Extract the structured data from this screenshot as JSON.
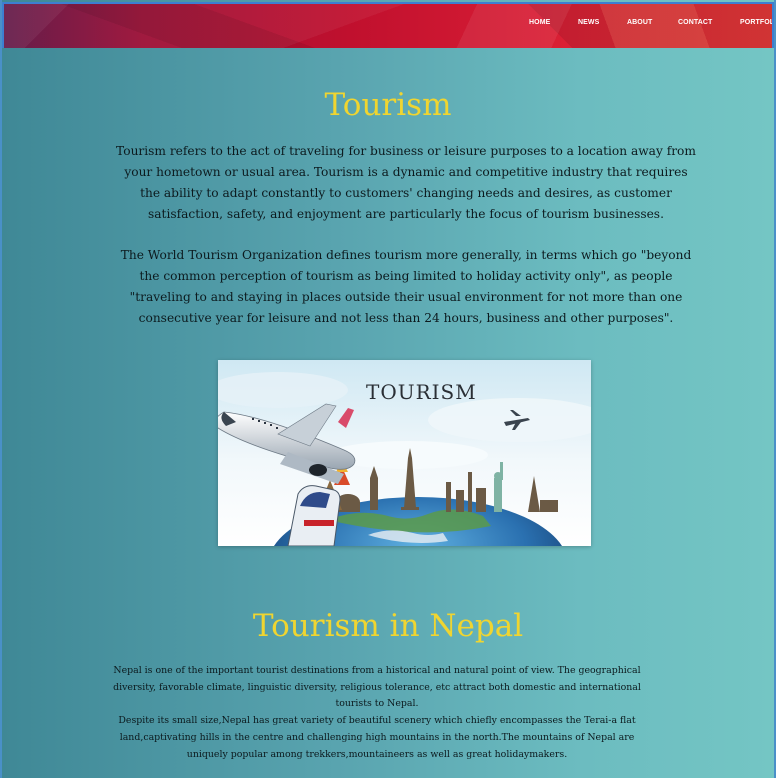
{
  "nav": {
    "links": [
      {
        "label": "HOME"
      },
      {
        "label": "NEWS"
      },
      {
        "label": "ABOUT"
      },
      {
        "label": "CONTACT"
      },
      {
        "label": "PORTFOLIO"
      }
    ]
  },
  "section_tourism": {
    "heading": "Tourism",
    "paragraph_1": "Tourism refers to the act of traveling for business or leisure purposes to a location away from your hometown or usual area. Tourism is a dynamic and competitive industry that requires the ability to adapt constantly to customers' changing needs and desires, as customer satisfaction, safety, and enjoyment are particularly the focus of tourism businesses.",
    "paragraph_2": "The World Tourism Organization defines tourism more generally, in terms which go \"beyond the common perception of tourism as being limited to holiday activity only\", as people \"traveling to and staying in places outside their usual environment for not more than one consecutive year for leisure and not less than 24 hours, business and other purposes\".",
    "image": {
      "caption_text": "TOURISM"
    }
  },
  "section_nepal": {
    "heading": "Tourism in Nepal",
    "paragraph_lines": [
      "Nepal is one of the important tourist destinations from a historical and natural point of view. The geographical diversity, favorable climate, linguistic diversity, religious tolerance, etc attract both domestic and international tourists to Nepal.",
      "Despite its small size,Nepal has great variety of beautiful scenery which chiefly encompasses the Terai-a flat land,captivating hills in the centre and challenging high mountains in the north.The mountains of Nepal are uniquely popular among trekkers,mountaineers as well as great holidaymakers."
    ]
  },
  "colors": {
    "heading": "#f0d530",
    "nav_gradient_start": "#5c1040",
    "nav_gradient_end": "#e83a3a",
    "background_left": "#3f8896",
    "background_right": "#74c6c4"
  }
}
